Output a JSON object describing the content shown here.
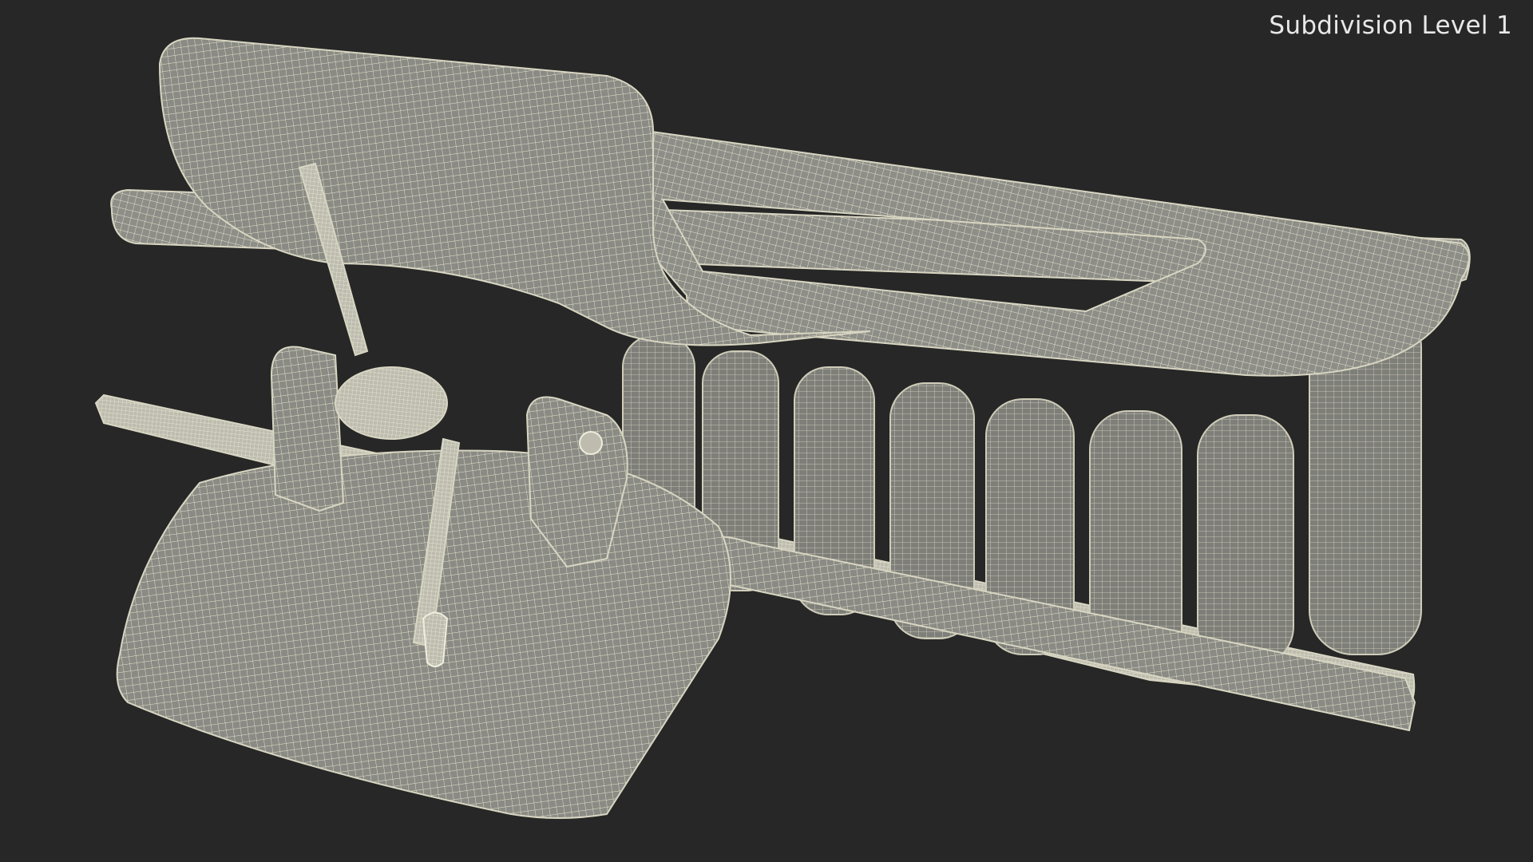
{
  "viewport": {
    "label": "Subdivision Level 1",
    "background_color": "#272727",
    "mesh_fill_color": "#8c8c86",
    "wire_color": "#e6e4cf"
  }
}
